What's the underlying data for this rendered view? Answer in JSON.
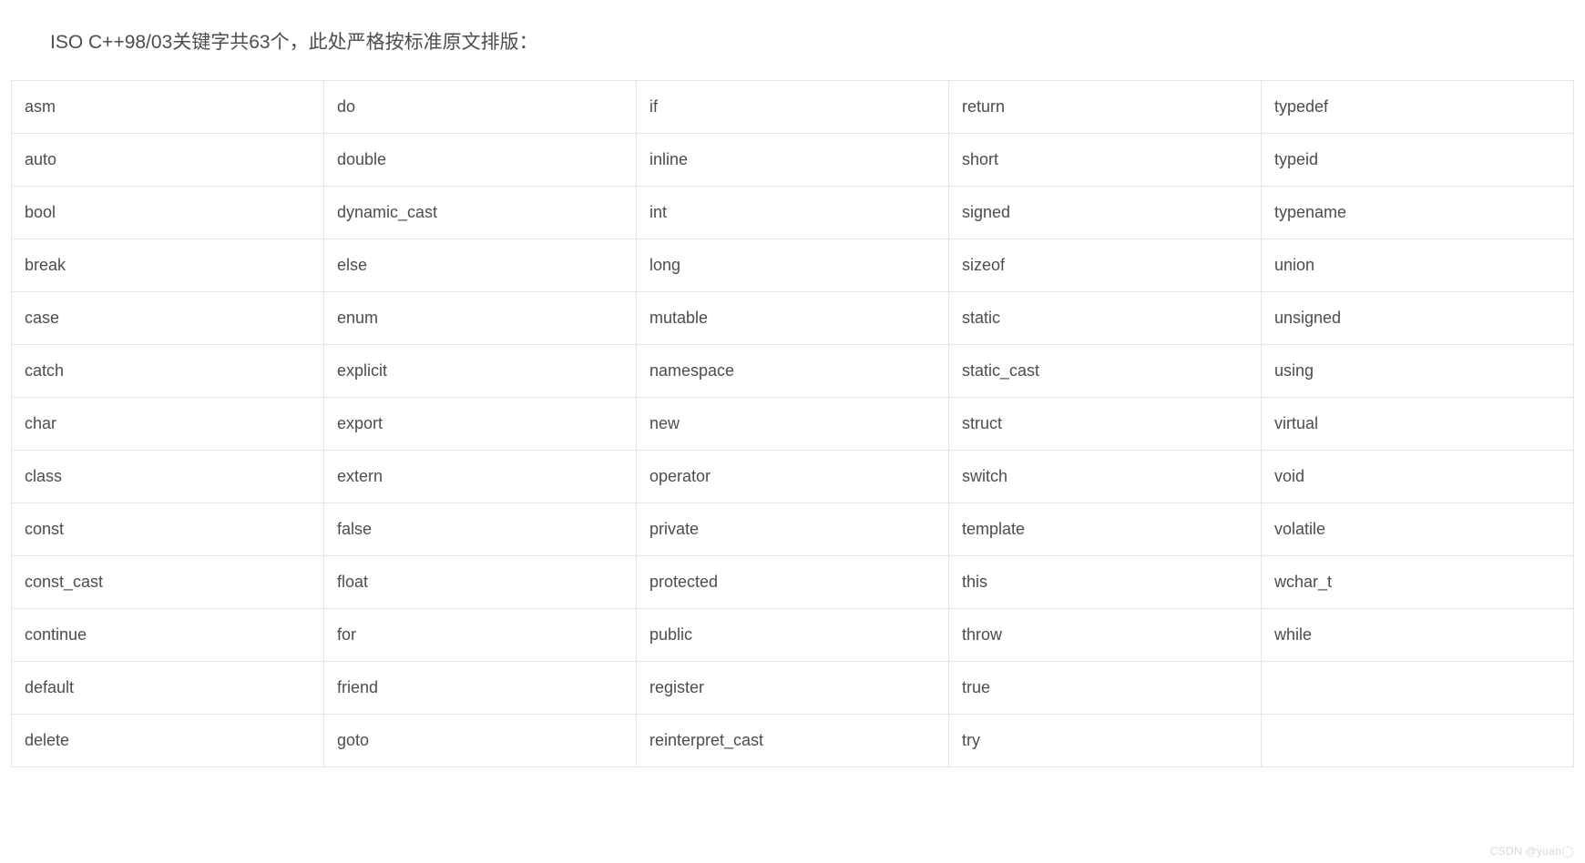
{
  "heading": "ISO C++98/03关键字共63个，此处严格按标准原文排版：",
  "rows": [
    [
      "asm",
      "do",
      "if",
      "return",
      "typedef"
    ],
    [
      "auto",
      "double",
      "inline",
      "short",
      "typeid"
    ],
    [
      "bool",
      "dynamic_cast",
      "int",
      "signed",
      "typename"
    ],
    [
      "break",
      "else",
      "long",
      "sizeof",
      "union"
    ],
    [
      "case",
      "enum",
      "mutable",
      "static",
      "unsigned"
    ],
    [
      "catch",
      "explicit",
      "namespace",
      "static_cast",
      "using"
    ],
    [
      "char",
      "export",
      "new",
      "struct",
      "virtual"
    ],
    [
      "class",
      "extern",
      "operator",
      "switch",
      "void"
    ],
    [
      "const",
      "false",
      "private",
      "template",
      "volatile"
    ],
    [
      "const_cast",
      "float",
      "protected",
      "this",
      "wchar_t"
    ],
    [
      "continue",
      "for",
      "public",
      "throw",
      "while"
    ],
    [
      "default",
      "friend",
      "register",
      "true",
      ""
    ],
    [
      "delete",
      "goto",
      "reinterpret_cast",
      "try",
      ""
    ]
  ],
  "watermark": "CSDN @yuan◯"
}
